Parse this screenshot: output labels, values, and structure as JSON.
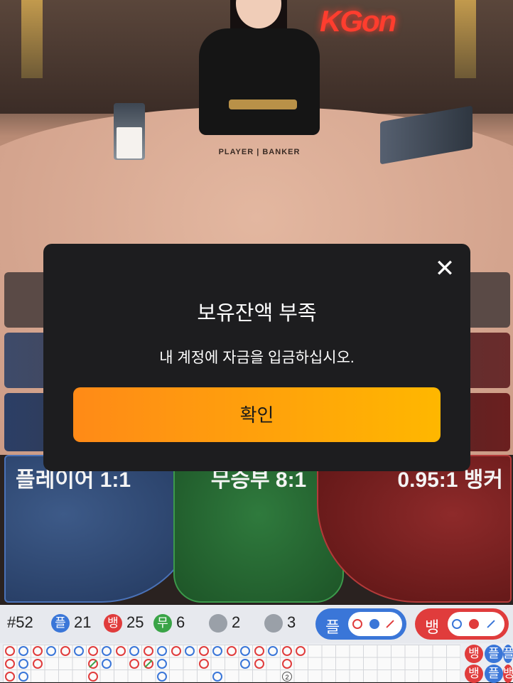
{
  "table": {
    "label": "PLAYER | BANKER",
    "brand": "KGon"
  },
  "bets": {
    "player": "플레이어 1:1",
    "tie": "무승부 8:1",
    "banker": "0.95:1 뱅커"
  },
  "modal": {
    "title": "보유잔액 부족",
    "message": "내 계정에 자금을 입금하십시오.",
    "confirm": "확인",
    "close": "✕"
  },
  "scoreboard": {
    "round": "#52",
    "player_label": "플",
    "player_count": "21",
    "banker_label": "뱅",
    "banker_count": "25",
    "tie_label": "무",
    "tie_count": "6",
    "player_pair_count": "2",
    "banker_pair_count": "3",
    "ask_player": "플",
    "ask_banker": "뱅",
    "pair_marker": "2",
    "side_tags": [
      "뱅",
      "플",
      "플",
      "뱅",
      "플",
      "뱅"
    ]
  },
  "colors": {
    "player": "#3a76d8",
    "banker": "#e03c3c",
    "tie": "#3aa447",
    "confirm_start": "#ff8a17",
    "confirm_end": "#ffb700"
  }
}
